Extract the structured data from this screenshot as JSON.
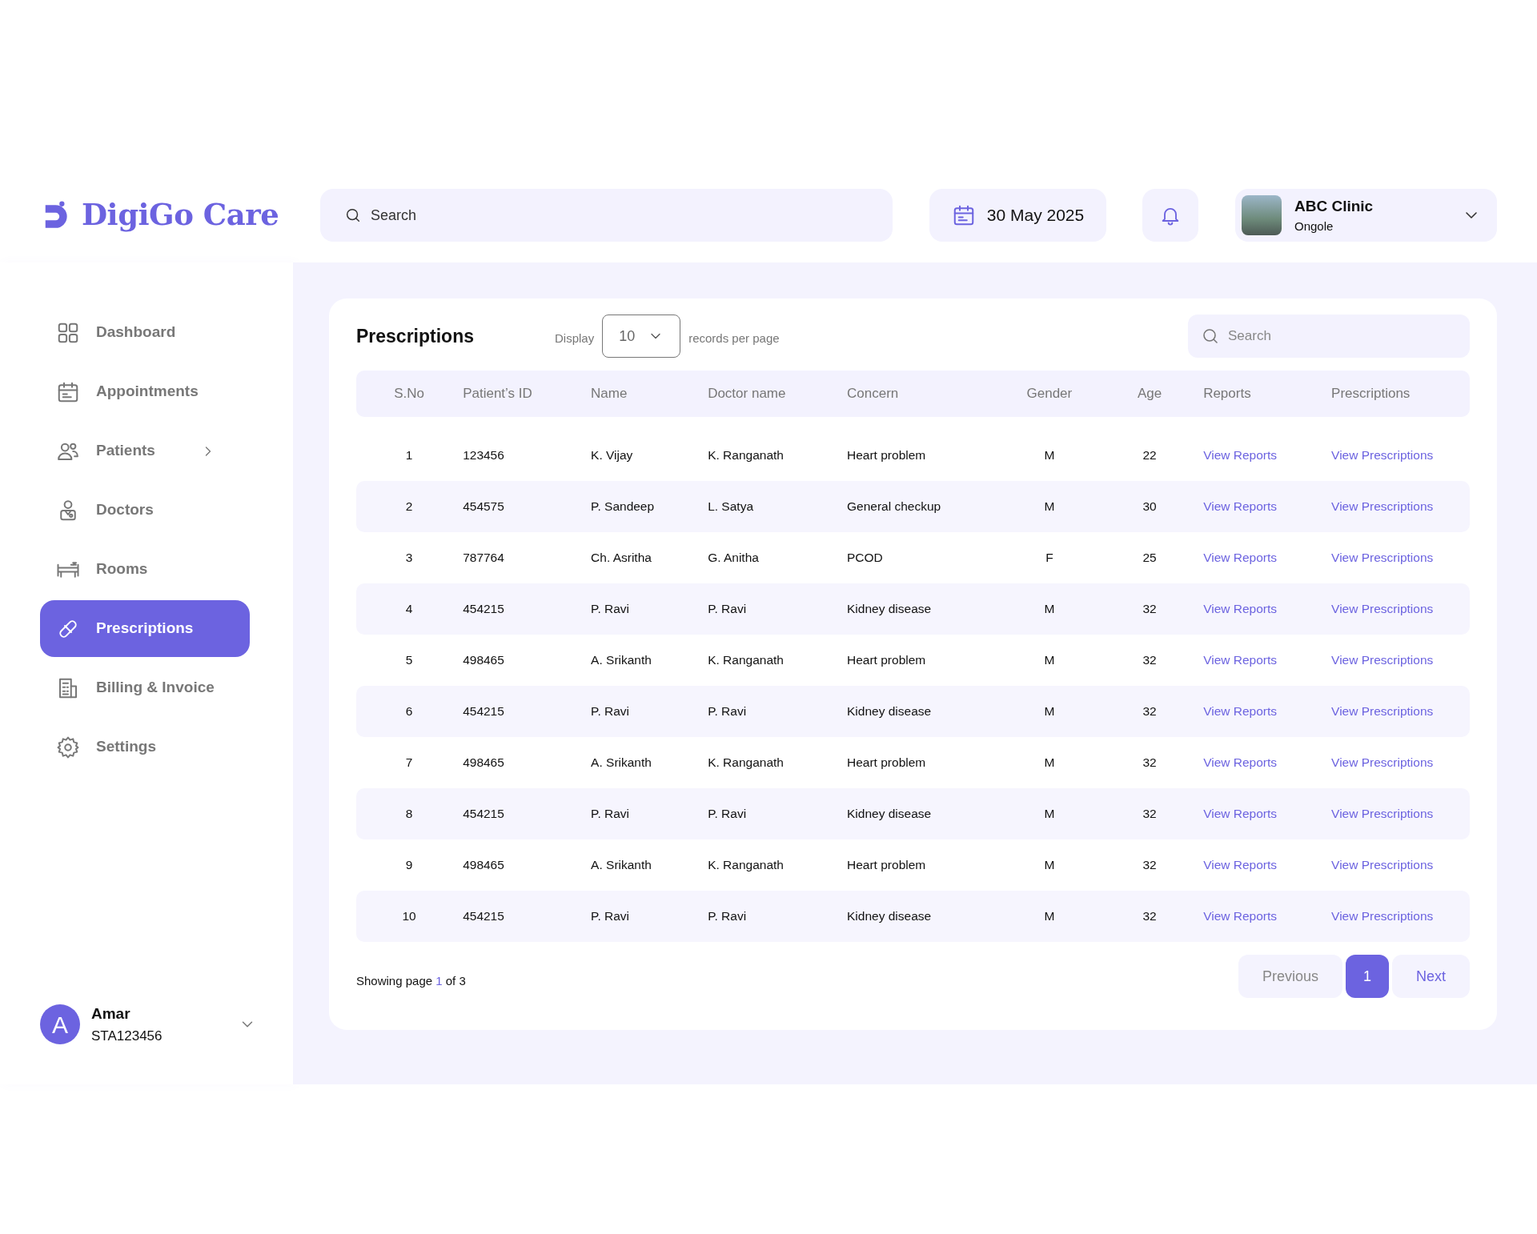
{
  "brand": {
    "name": "DigiGo Care"
  },
  "header": {
    "search": {
      "placeholder": "Search"
    },
    "date": "30 May 2025",
    "clinic": {
      "name": "ABC Clinic",
      "location": "Ongole"
    }
  },
  "sidebar": {
    "items": [
      {
        "label": "Dashboard",
        "kind": "grid",
        "selected": false,
        "has_submenu": false
      },
      {
        "label": "Appointments",
        "kind": "calendar",
        "selected": false,
        "has_submenu": false
      },
      {
        "label": "Patients",
        "kind": "people",
        "selected": false,
        "has_submenu": true
      },
      {
        "label": "Doctors",
        "kind": "doctor",
        "selected": false,
        "has_submenu": false
      },
      {
        "label": "Rooms",
        "kind": "bed",
        "selected": false,
        "has_submenu": false
      },
      {
        "label": "Prescriptions",
        "kind": "pill",
        "selected": true,
        "has_submenu": false
      },
      {
        "label": "Billing & Invoice",
        "kind": "receipt",
        "selected": false,
        "has_submenu": false
      },
      {
        "label": "Settings",
        "kind": "gear",
        "selected": false,
        "has_submenu": false
      }
    ],
    "user": {
      "initial": "A",
      "name": "Amar",
      "id": "STA123456"
    }
  },
  "panel": {
    "title": "Prescriptions",
    "display_label": "Display",
    "per_page": "10",
    "per_page_suffix": "records per page",
    "search": {
      "placeholder": "Search"
    }
  },
  "table": {
    "columns": [
      "S.No",
      "Patient’s ID",
      "Name",
      "Doctor name",
      "Concern",
      "Gender",
      "Age",
      "Reports",
      "Prescriptions"
    ],
    "rows": [
      [
        "1",
        "123456",
        "K. Vijay",
        "K. Ranganath",
        "Heart problem",
        "M",
        "22",
        "View Reports",
        "View Prescriptions"
      ],
      [
        "2",
        "454575",
        "P. Sandeep",
        "L. Satya",
        "General checkup",
        "M",
        "30",
        "View Reports",
        "View Prescriptions"
      ],
      [
        "3",
        "787764",
        "Ch. Asritha",
        "G. Anitha",
        "PCOD",
        "F",
        "25",
        "View Reports",
        "View Prescriptions"
      ],
      [
        "4",
        "454215",
        "P. Ravi",
        "P. Ravi",
        "Kidney disease",
        "M",
        "32",
        "View Reports",
        "View Prescriptions"
      ],
      [
        "5",
        "498465",
        "A. Srikanth",
        "K. Ranganath",
        "Heart problem",
        "M",
        "32",
        "View Reports",
        "View Prescriptions"
      ],
      [
        "6",
        "454215",
        "P. Ravi",
        "P. Ravi",
        "Kidney disease",
        "M",
        "32",
        "View Reports",
        "View Prescriptions"
      ],
      [
        "7",
        "498465",
        "A. Srikanth",
        "K. Ranganath",
        "Heart problem",
        "M",
        "32",
        "View Reports",
        "View Prescriptions"
      ],
      [
        "8",
        "454215",
        "P. Ravi",
        "P. Ravi",
        "Kidney disease",
        "M",
        "32",
        "View Reports",
        "View Prescriptions"
      ],
      [
        "9",
        "498465",
        "A. Srikanth",
        "K. Ranganath",
        "Heart problem",
        "M",
        "32",
        "View Reports",
        "View Prescriptions"
      ],
      [
        "10",
        "454215",
        "P. Ravi",
        "P. Ravi",
        "Kidney disease",
        "M",
        "32",
        "View Reports",
        "View Prescriptions"
      ]
    ]
  },
  "footer": {
    "status": "Showing page **1** of 3",
    "pagination": {
      "previous": {
        "label": "Previous",
        "disabled": true
      },
      "pages": [
        {
          "label": "1",
          "selected": true
        }
      ],
      "next": {
        "label": "Next",
        "disabled": false
      }
    }
  }
}
